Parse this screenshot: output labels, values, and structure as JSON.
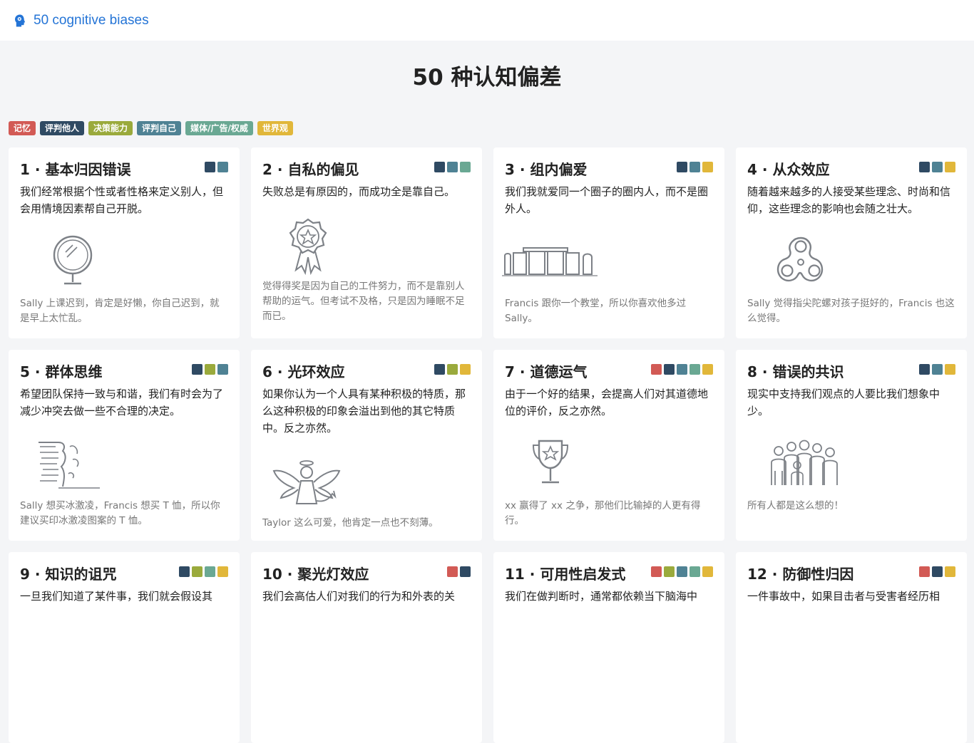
{
  "header": {
    "title": "50 cognitive biases",
    "icon": "brain-head-icon"
  },
  "page_title": "50 种认知偏差",
  "colors": {
    "memory": "#d25a55",
    "judge_others": "#2f4a63",
    "decision": "#9aaa3c",
    "judge_self": "#4f8294",
    "media": "#6aa893",
    "worldview": "#e1b73a"
  },
  "legend": [
    {
      "label": "记忆",
      "color": "#d25a55"
    },
    {
      "label": "评判他人",
      "color": "#2f4a63"
    },
    {
      "label": "决策能力",
      "color": "#9aaa3c"
    },
    {
      "label": "评判自己",
      "color": "#4f8294"
    },
    {
      "label": "媒体/广告/权威",
      "color": "#6aa893"
    },
    {
      "label": "世界观",
      "color": "#e1b73a"
    }
  ],
  "cards": [
    {
      "title": "1 · 基本归因错误",
      "colors": [
        "#2f4a63",
        "#4f8294"
      ],
      "desc": "我们经常根据个性或者性格来定义别人，但会用情境因素帮自己开脱。",
      "example": "Sally 上课迟到，肯定是好懒，你自己迟到，就是早上太忙乱。",
      "icon": "mirror-icon"
    },
    {
      "title": "2 · 自私的偏见",
      "colors": [
        "#2f4a63",
        "#4f8294",
        "#6aa893"
      ],
      "desc": "失败总是有原因的，而成功全是靠自己。",
      "example": "觉得得奖是因为自己的工件努力，而不是靠别人帮助的运气。但考试不及格，只是因为睡眠不足而已。",
      "icon": "award-ribbon-icon"
    },
    {
      "title": "3 · 组内偏爱",
      "colors": [
        "#2f4a63",
        "#4f8294",
        "#e1b73a"
      ],
      "desc": "我们我就爱同一个圈子的圈内人，而不是圈外人。",
      "example": "Francis 跟你一个教堂，所以你喜欢他多过 Sally。",
      "icon": "stonehenge-icon"
    },
    {
      "title": "4 · 从众效应",
      "colors": [
        "#2f4a63",
        "#4f8294",
        "#e1b73a"
      ],
      "desc": "随着越来越多的人接受某些理念、时尚和信仰，这些理念的影响也会随之壮大。",
      "example": "Sally 觉得指尖陀螺对孩子挺好的，Francis 也这么觉得。",
      "icon": "fidget-spinner-icon"
    },
    {
      "title": "5 · 群体思维",
      "colors": [
        "#2f4a63",
        "#9aaa3c",
        "#4f8294"
      ],
      "desc": "希望团队保持一致与和谐，我们有时会为了减少冲突去做一些不合理的决定。",
      "example": "Sally 想买冰激凌，Francis 想买 T 恤，所以你建议买印冰激凌图案的 T 恤。",
      "icon": "cliff-icon"
    },
    {
      "title": "6 · 光环效应",
      "colors": [
        "#2f4a63",
        "#9aaa3c",
        "#e1b73a"
      ],
      "desc": "如果你认为一个人具有某种积极的特质，那么这种积极的印象会溢出到他的其它特质中。反之亦然。",
      "example": "Taylor 这么可爱，他肯定一点也不刻薄。",
      "icon": "angel-icon"
    },
    {
      "title": "7 · 道德运气",
      "colors": [
        "#d25a55",
        "#2f4a63",
        "#4f8294",
        "#6aa893",
        "#e1b73a"
      ],
      "desc": "由于一个好的结果，会提高人们对其道德地位的评价，反之亦然。",
      "example": "xx 赢得了 xx 之争，那他们比输掉的人更有得行。",
      "icon": "trophy-icon"
    },
    {
      "title": "8 · 错误的共识",
      "colors": [
        "#2f4a63",
        "#4f8294",
        "#e1b73a"
      ],
      "desc": "现实中支持我们观点的人要比我们想象中少。",
      "example": "所有人都是这么想的！",
      "icon": "crowd-icon"
    },
    {
      "title": "9 · 知识的诅咒",
      "colors": [
        "#2f4a63",
        "#9aaa3c",
        "#6aa893",
        "#e1b73a"
      ],
      "desc": "一旦我们知道了某件事，我们就会假设其",
      "example": "",
      "icon": ""
    },
    {
      "title": "10 · 聚光灯效应",
      "colors": [
        "#d25a55",
        "#2f4a63"
      ],
      "desc": "我们会高估人们对我们的行为和外表的关",
      "example": "",
      "icon": ""
    },
    {
      "title": "11 · 可用性启发式",
      "colors": [
        "#d25a55",
        "#9aaa3c",
        "#4f8294",
        "#6aa893",
        "#e1b73a"
      ],
      "desc": "我们在做判断时，通常都依赖当下脑海中",
      "example": "",
      "icon": ""
    },
    {
      "title": "12 · 防御性归因",
      "colors": [
        "#d25a55",
        "#2f4a63",
        "#e1b73a"
      ],
      "desc": "一件事故中，如果目击者与受害者经历相",
      "example": "",
      "icon": ""
    }
  ]
}
